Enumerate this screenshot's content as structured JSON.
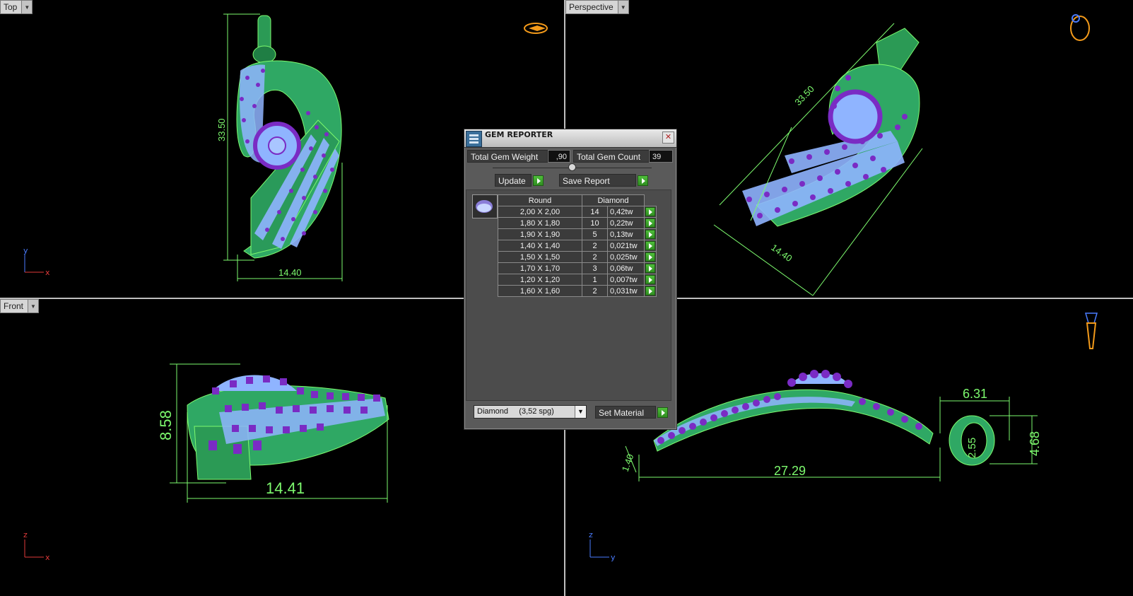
{
  "viewports": {
    "top": {
      "label": "Top",
      "axis_x": "x",
      "axis_y": "y",
      "dims": {
        "height": "33.50",
        "width": "14.40"
      }
    },
    "perspective": {
      "label": "Perspective",
      "dims": {
        "height": "33.50",
        "width": "14.40"
      }
    },
    "front": {
      "label": "Front",
      "axis_x": "x",
      "axis_y": "z",
      "dims": {
        "height": "8.58",
        "width": "14.41"
      }
    },
    "right": {
      "axis_x": "y",
      "axis_y": "z",
      "dims": {
        "length": "27.29",
        "bail_width": "6.31",
        "bail_inner": "2.55",
        "bail_height": "4.68",
        "tip": "1.40"
      }
    }
  },
  "gem_reporter": {
    "title": "GEM REPORTER",
    "close_glyph": "✕",
    "total_weight_label": "Total Gem Weight",
    "total_weight_value": ",90",
    "total_count_label": "Total Gem Count",
    "total_count_value": "39",
    "update_label": "Update",
    "save_label": "Save Report",
    "table": {
      "header_shape": "Round",
      "header_material": "Diamond",
      "rows": [
        {
          "size": "2,00 X 2,00",
          "count": "14",
          "weight": "0,42tw"
        },
        {
          "size": "1,80 X 1,80",
          "count": "10",
          "weight": "0,22tw"
        },
        {
          "size": "1,90 X 1,90",
          "count": "5",
          "weight": "0,13tw"
        },
        {
          "size": "1,40 X 1,40",
          "count": "2",
          "weight": "0,021tw"
        },
        {
          "size": "1,50 X 1,50",
          "count": "2",
          "weight": "0,025tw"
        },
        {
          "size": "1,70 X 1,70",
          "count": "3",
          "weight": "0,06tw"
        },
        {
          "size": "1,20 X 1,20",
          "count": "1",
          "weight": "0,007tw"
        },
        {
          "size": "1,60 X 1,60",
          "count": "2",
          "weight": "0,031tw"
        }
      ]
    },
    "material_select": "Diamond     (3,52 spg)",
    "set_material_label": "Set Material"
  },
  "colors": {
    "metal": "#2fbf6a",
    "wire": "#7dfa6e",
    "gem": "#8fb4ff",
    "prong": "#7a2bc4",
    "background": "#000000"
  }
}
